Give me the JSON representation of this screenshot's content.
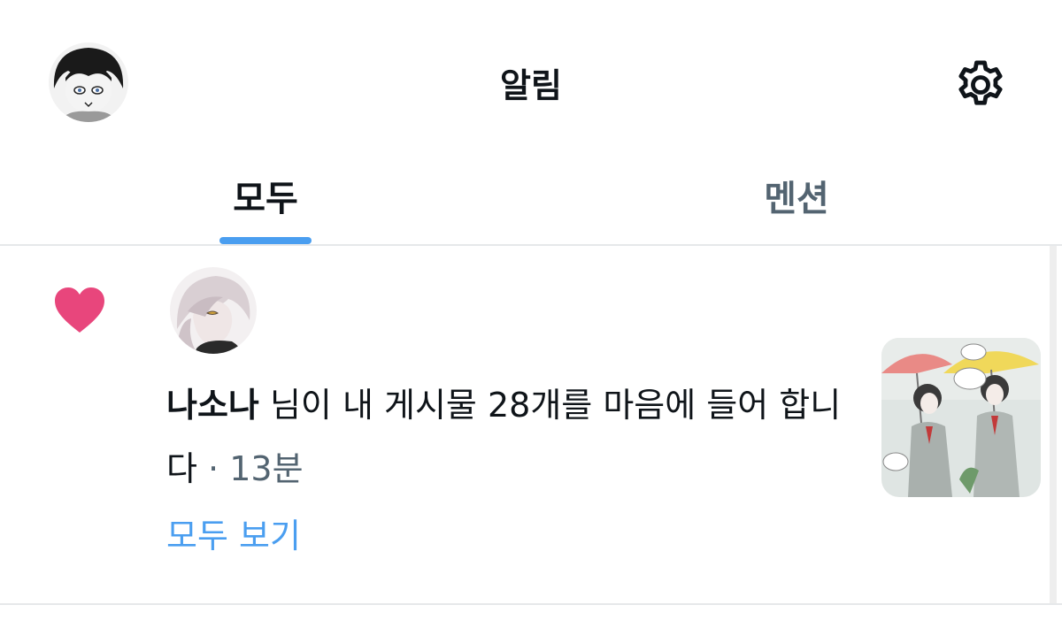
{
  "header": {
    "title": "알림",
    "avatar_icon": "user-avatar",
    "settings_icon": "gear-icon"
  },
  "tabs": [
    {
      "label": "모두",
      "active": true
    },
    {
      "label": "멘션",
      "active": false
    }
  ],
  "notification": {
    "icon": "heart-icon",
    "icon_color": "#e8467c",
    "actor_name": "나소나",
    "message": " 님이 내 게시물 28개를 마음에 들어 합니다",
    "separator": " · ",
    "time": "13분",
    "view_all_label": "모두 보기"
  },
  "colors": {
    "accent": "#4a9ef0",
    "text_primary": "#0f1419",
    "text_secondary": "#536471",
    "heart": "#e8467c"
  }
}
